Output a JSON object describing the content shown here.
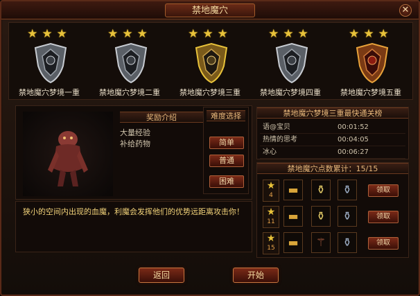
{
  "window": {
    "title": "禁地魔穴"
  },
  "stages": [
    {
      "name": "禁地魔穴梦境一重",
      "stars": 3,
      "selected": false
    },
    {
      "name": "禁地魔穴梦境二重",
      "stars": 3,
      "selected": false
    },
    {
      "name": "禁地魔穴梦境三重",
      "stars": 3,
      "selected": true
    },
    {
      "name": "禁地魔穴梦境四重",
      "stars": 3,
      "selected": false
    },
    {
      "name": "禁地魔穴梦境五重",
      "stars": 3,
      "selected": false
    }
  ],
  "rewards": {
    "header": "奖励介绍",
    "items": [
      "大量经验",
      "补给药物"
    ]
  },
  "difficulty": {
    "header": "难度选择",
    "options": [
      "简单",
      "普通",
      "困难"
    ]
  },
  "description": "狭小的空间内出现的血魔，利魔会发挥他们的优势远距离攻击你！",
  "ranking": {
    "header": "禁地魔穴梦境三重最快通关榜",
    "rows": [
      {
        "name": "语@宝贝",
        "time": "00:01:52"
      },
      {
        "name": "热情的思考",
        "time": "00:04:05"
      },
      {
        "name": "冰心",
        "time": "00:06:27"
      }
    ]
  },
  "points": {
    "header": "禁地魔穴点数累计：15/15",
    "tiers": [
      {
        "level": "4",
        "claim": "领取"
      },
      {
        "level": "11",
        "claim": "领取"
      },
      {
        "level": "15",
        "claim": "领取"
      }
    ]
  },
  "buttons": {
    "back": "返回",
    "start": "开始"
  },
  "colors": {
    "accent": "#e8c23a",
    "frame": "#5a2a18",
    "button": "#7a2a17"
  }
}
